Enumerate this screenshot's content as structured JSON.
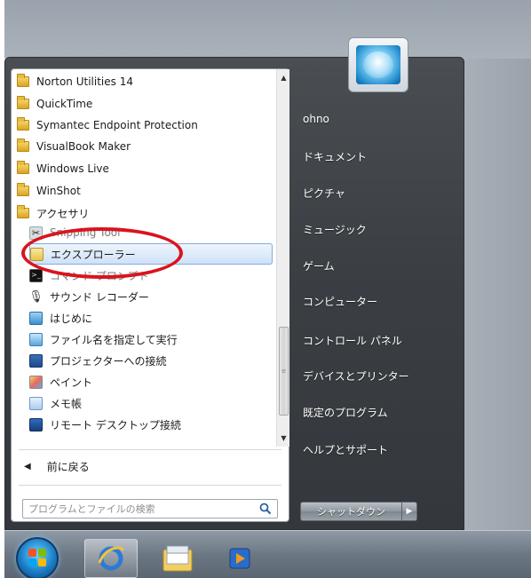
{
  "programs": [
    {
      "label": "Norton Utilities 14",
      "icon": "folder-icon"
    },
    {
      "label": "QuickTime",
      "icon": "folder-icon"
    },
    {
      "label": "Symantec Endpoint Protection",
      "icon": "folder-icon"
    },
    {
      "label": "VisualBook Maker",
      "icon": "folder-icon"
    },
    {
      "label": "Windows Live",
      "icon": "folder-icon"
    },
    {
      "label": "WinShot",
      "icon": "folder-icon"
    },
    {
      "label": "アクセサリ",
      "icon": "folder-icon"
    },
    {
      "label": "Snipping Tool",
      "icon": "snipping-tool-icon"
    },
    {
      "label": "エクスプローラー",
      "icon": "explorer-icon"
    },
    {
      "label": "コマンド プロンプト",
      "icon": "command-prompt-icon"
    },
    {
      "label": "サウンド レコーダー",
      "icon": "microphone-icon"
    },
    {
      "label": "はじめに",
      "icon": "getting-started-icon"
    },
    {
      "label": "ファイル名を指定して実行",
      "icon": "run-icon"
    },
    {
      "label": "プロジェクターへの接続",
      "icon": "projector-icon"
    },
    {
      "label": "ペイント",
      "icon": "paint-icon"
    },
    {
      "label": "メモ帳",
      "icon": "notepad-icon"
    },
    {
      "label": "リモート デスクトップ接続",
      "icon": "remote-desktop-icon"
    }
  ],
  "selected_program": "エクスプローラー",
  "back_label": "前に戻る",
  "search": {
    "placeholder": "プログラムとファイルの検索"
  },
  "right_links": {
    "user": "ohno",
    "documents": "ドキュメント",
    "pictures": "ピクチャ",
    "music": "ミュージック",
    "games": "ゲーム",
    "computer": "コンピューター",
    "control_panel": "コントロール パネル",
    "devices": "デバイスとプリンター",
    "default_programs": "既定のプログラム",
    "help": "ヘルプとサポート"
  },
  "shutdown": {
    "label": "シャットダウン"
  },
  "colors": {
    "highlight_ring": "#d9141e",
    "selection": "#cfe2f8"
  },
  "taskbar": {
    "items": [
      "start-orb-icon",
      "internet-explorer-icon",
      "file-explorer-icon",
      "media-player-icon"
    ]
  }
}
